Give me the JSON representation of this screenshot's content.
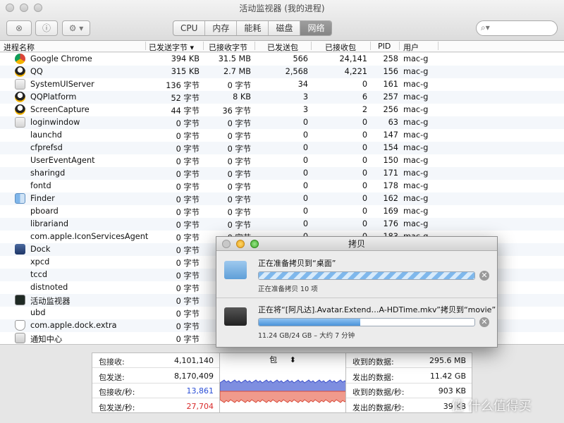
{
  "window": {
    "title": "活动监视器 (我的进程)"
  },
  "toolbar": {
    "tabs": [
      {
        "label": "CPU"
      },
      {
        "label": "内存"
      },
      {
        "label": "能耗"
      },
      {
        "label": "磁盘"
      },
      {
        "label": "网络",
        "active": true
      }
    ],
    "search_placeholder": ""
  },
  "table": {
    "columns": [
      "进程名称",
      "已发送字节",
      "已接收字节",
      "已发送包",
      "已接收包",
      "PID",
      "用户"
    ],
    "rows": [
      {
        "name": "Google Chrome",
        "sent_bytes": "394 KB",
        "recv_bytes": "31.5 MB",
        "sent_pkts": "566",
        "recv_pkts": "24,141",
        "pid": "258",
        "user": "mac-g",
        "icon": "chrome-icon"
      },
      {
        "name": "QQ",
        "sent_bytes": "315 KB",
        "recv_bytes": "2.7 MB",
        "sent_pkts": "2,568",
        "recv_pkts": "4,221",
        "pid": "156",
        "user": "mac-g",
        "icon": "qq-icon"
      },
      {
        "name": "SystemUIServer",
        "sent_bytes": "136 字节",
        "recv_bytes": "0 字节",
        "sent_pkts": "34",
        "recv_pkts": "0",
        "pid": "161",
        "user": "mac-g",
        "icon": "app-icon"
      },
      {
        "name": "QQPlatform",
        "sent_bytes": "52 字节",
        "recv_bytes": "8 KB",
        "sent_pkts": "3",
        "recv_pkts": "6",
        "pid": "257",
        "user": "mac-g",
        "icon": "qq-icon"
      },
      {
        "name": "ScreenCapture",
        "sent_bytes": "44 字节",
        "recv_bytes": "36 字节",
        "sent_pkts": "3",
        "recv_pkts": "2",
        "pid": "256",
        "user": "mac-g",
        "icon": "qq-icon"
      },
      {
        "name": "loginwindow",
        "sent_bytes": "0 字节",
        "recv_bytes": "0 字节",
        "sent_pkts": "0",
        "recv_pkts": "0",
        "pid": "63",
        "user": "mac-g",
        "icon": "app-icon"
      },
      {
        "name": "launchd",
        "sent_bytes": "0 字节",
        "recv_bytes": "0 字节",
        "sent_pkts": "0",
        "recv_pkts": "0",
        "pid": "147",
        "user": "mac-g",
        "icon": ""
      },
      {
        "name": "cfprefsd",
        "sent_bytes": "0 字节",
        "recv_bytes": "0 字节",
        "sent_pkts": "0",
        "recv_pkts": "0",
        "pid": "154",
        "user": "mac-g",
        "icon": ""
      },
      {
        "name": "UserEventAgent",
        "sent_bytes": "0 字节",
        "recv_bytes": "0 字节",
        "sent_pkts": "0",
        "recv_pkts": "0",
        "pid": "150",
        "user": "mac-g",
        "icon": ""
      },
      {
        "name": "sharingd",
        "sent_bytes": "0 字节",
        "recv_bytes": "0 字节",
        "sent_pkts": "0",
        "recv_pkts": "0",
        "pid": "171",
        "user": "mac-g",
        "icon": ""
      },
      {
        "name": "fontd",
        "sent_bytes": "0 字节",
        "recv_bytes": "0 字节",
        "sent_pkts": "0",
        "recv_pkts": "0",
        "pid": "178",
        "user": "mac-g",
        "icon": ""
      },
      {
        "name": "Finder",
        "sent_bytes": "0 字节",
        "recv_bytes": "0 字节",
        "sent_pkts": "0",
        "recv_pkts": "0",
        "pid": "162",
        "user": "mac-g",
        "icon": "finder-icon"
      },
      {
        "name": "pboard",
        "sent_bytes": "0 字节",
        "recv_bytes": "0 字节",
        "sent_pkts": "0",
        "recv_pkts": "0",
        "pid": "169",
        "user": "mac-g",
        "icon": ""
      },
      {
        "name": "librariand",
        "sent_bytes": "0 字节",
        "recv_bytes": "0 字节",
        "sent_pkts": "0",
        "recv_pkts": "0",
        "pid": "176",
        "user": "mac-g",
        "icon": ""
      },
      {
        "name": "com.apple.IconServicesAgent",
        "sent_bytes": "0 字节",
        "recv_bytes": "0 字节",
        "sent_pkts": "0",
        "recv_pkts": "0",
        "pid": "183",
        "user": "mac-g",
        "icon": ""
      },
      {
        "name": "Dock",
        "sent_bytes": "0 字节",
        "recv_bytes": "",
        "sent_pkts": "",
        "recv_pkts": "",
        "pid": "",
        "user": "",
        "icon": "dock-icon"
      },
      {
        "name": "xpcd",
        "sent_bytes": "0 字节",
        "recv_bytes": "",
        "sent_pkts": "",
        "recv_pkts": "",
        "pid": "",
        "user": "",
        "icon": ""
      },
      {
        "name": "tccd",
        "sent_bytes": "0 字节",
        "recv_bytes": "",
        "sent_pkts": "",
        "recv_pkts": "",
        "pid": "",
        "user": "",
        "icon": ""
      },
      {
        "name": "distnoted",
        "sent_bytes": "0 字节",
        "recv_bytes": "",
        "sent_pkts": "",
        "recv_pkts": "",
        "pid": "",
        "user": "",
        "icon": ""
      },
      {
        "name": "活动监视器",
        "sent_bytes": "0 字节",
        "recv_bytes": "",
        "sent_pkts": "",
        "recv_pkts": "",
        "pid": "",
        "user": "",
        "icon": "activity-monitor-icon"
      },
      {
        "name": "ubd",
        "sent_bytes": "0 字节",
        "recv_bytes": "",
        "sent_pkts": "",
        "recv_pkts": "",
        "pid": "",
        "user": "",
        "icon": ""
      },
      {
        "name": "com.apple.dock.extra",
        "sent_bytes": "0 字节",
        "recv_bytes": "",
        "sent_pkts": "",
        "recv_pkts": "",
        "pid": "",
        "user": "",
        "icon": "shield-icon"
      },
      {
        "name": "通知中心",
        "sent_bytes": "0 字节",
        "recv_bytes": "",
        "sent_pkts": "",
        "recv_pkts": "",
        "pid": "",
        "user": "",
        "icon": "notification-icon"
      }
    ]
  },
  "stats_left": [
    {
      "label": "包接收:",
      "value": "4,101,140",
      "color": "#111111"
    },
    {
      "label": "包发送:",
      "value": "8,170,409",
      "color": "#111111"
    },
    {
      "label": "包接收/秒:",
      "value": "13,861",
      "color": "#2a4ed6"
    },
    {
      "label": "包发送/秒:",
      "value": "27,704",
      "color": "#d82a2a"
    }
  ],
  "graph": {
    "selector_label": "包"
  },
  "stats_right": [
    {
      "label": "收到的数据:",
      "value": "295.6 MB"
    },
    {
      "label": "发出的数据:",
      "value": "11.42 GB"
    },
    {
      "label": "收到的数据/秒:",
      "value": "903 KB"
    },
    {
      "label": "发出的数据/秒:",
      "value": "39 KB"
    }
  ],
  "copy_dialog": {
    "title": "拷贝",
    "tasks": [
      {
        "title": "正在准备拷贝到“桌面”",
        "status": "正在准备拷贝 10 项",
        "progress": 1.0,
        "indeterminate": true,
        "icon": "folder-icon"
      },
      {
        "title": "正在将“[阿凡达].Avatar.Extend…A-HDTime.mkv”拷贝到“movie”",
        "status": "11.24 GB/24 GB – 大约 7 分钟",
        "progress": 0.47,
        "indeterminate": false,
        "icon": "file-icon"
      }
    ]
  },
  "watermark": "值 什么值得买"
}
